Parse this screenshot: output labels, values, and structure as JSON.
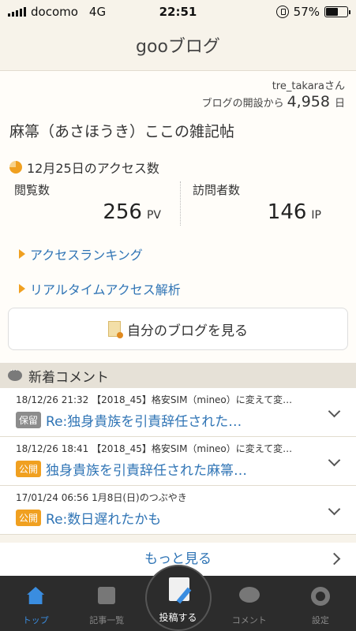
{
  "status": {
    "carrier": "docomo",
    "network": "4G",
    "time": "22:51",
    "battery": "57%",
    "battery_level": 0.57
  },
  "header": {
    "title": "gooブログ"
  },
  "profile": {
    "username": "tre_takaraさん",
    "since_label": "ブログの開設から",
    "since_value": "4,958",
    "since_unit": "日",
    "blog_name": "麻箒（あさほうき）ここの雑記帖"
  },
  "access": {
    "date_label": "12月25日のアクセス数",
    "pv_label": "閲覧数",
    "pv_value": "256",
    "pv_unit": "PV",
    "ip_label": "訪問者数",
    "ip_value": "146",
    "ip_unit": "IP"
  },
  "links": {
    "ranking": "アクセスランキング",
    "realtime": "リアルタイムアクセス解析",
    "my_blog": "自分のブログを見る"
  },
  "comments": {
    "heading": "新着コメント",
    "items": [
      {
        "meta": "18/12/26 21:32 【2018_45】格安SIM（mineo）に変えて変…",
        "badge": "保留",
        "badge_color": "#8c8c8c",
        "title": "Re:独身貴族を引責辞任された…"
      },
      {
        "meta": "18/12/26 18:41 【2018_45】格安SIM（mineo）に変えて変…",
        "badge": "公開",
        "badge_color": "#f0a020",
        "title": "独身貴族を引責辞任された麻箒…"
      },
      {
        "meta": "17/01/24 06:56 1月8日(日)のつぶやき",
        "badge": "公開",
        "badge_color": "#f0a020",
        "title": "Re:数日遅れたかも"
      }
    ],
    "more": "もっと見る"
  },
  "tabs": {
    "top": "トップ",
    "articles": "記事一覧",
    "post": "投稿する",
    "comment": "コメント",
    "settings": "設定"
  }
}
